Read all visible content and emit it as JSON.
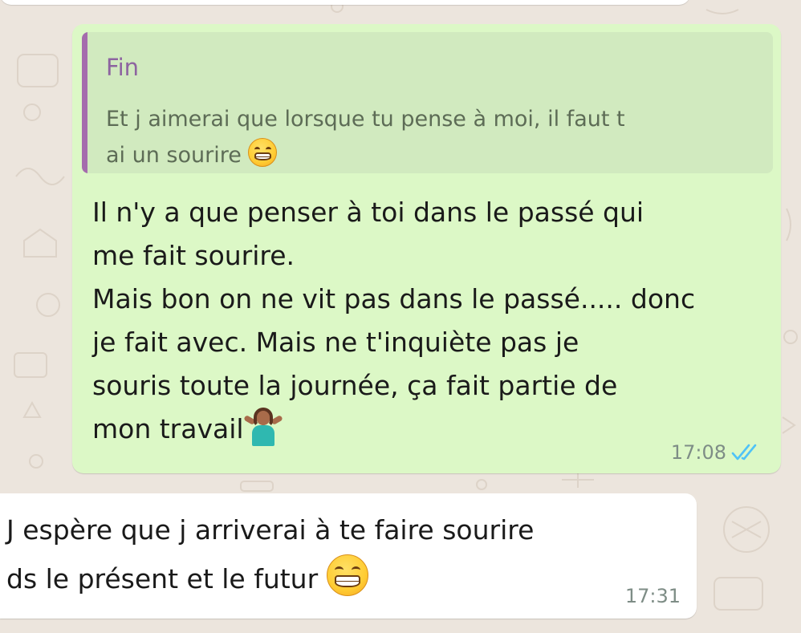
{
  "quoted_reply": {
    "sender": "Fin",
    "text_lines": [
      "Et j aimerai que lorsque tu pense à moi, il faut t",
      "ai un sourire"
    ],
    "emoji": "grinning-face"
  },
  "outgoing_message": {
    "lines": [
      "Il n'y a que penser à toi dans le passé qui",
      "me fait sourire.",
      "Mais bon on ne vit pas dans le passé..... donc",
      "je fait avec.   Mais ne t'inquiète pas je",
      "souris toute la journée, ça fait partie de",
      "mon travail"
    ],
    "emoji": "person-shrugging",
    "time": "17:08",
    "status": "read",
    "status_color": "#4fc3f7"
  },
  "incoming_message": {
    "lines": [
      "J espère que j arriverai  à te faire sourire",
      "ds le présent et le futur"
    ],
    "emoji": "grinning-face",
    "time": "17:31"
  },
  "colors": {
    "wallpaper": "#ece5dd",
    "outgoing_bubble": "#dcf8c6",
    "quote_background": "#d1eabf",
    "quote_bar": "#a56cad",
    "incoming_bubble": "#ffffff"
  }
}
